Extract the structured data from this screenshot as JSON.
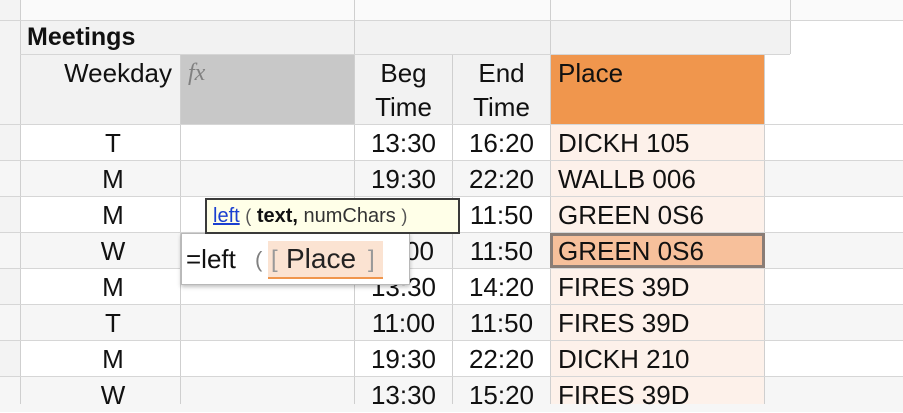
{
  "section_title": "Meetings",
  "headers": {
    "weekday": "Weekday",
    "fx_icon": "fx",
    "beg_line1": "Beg",
    "beg_line2": "Time",
    "end_line1": "End",
    "end_line2": "Time",
    "place": "Place"
  },
  "rows": [
    {
      "weekday": "T",
      "beg": "13:30",
      "end": "16:20",
      "place": "DICKH 105"
    },
    {
      "weekday": "M",
      "beg": "19:30",
      "end": "22:20",
      "place": "WALLB 006"
    },
    {
      "weekday": "M",
      "beg": "",
      "end": "11:50",
      "place": "GREEN 0S6"
    },
    {
      "weekday": "W",
      "beg": "",
      "end": "11:50",
      "place": "GREEN 0S6"
    },
    {
      "weekday": "M",
      "beg": "13:30",
      "end": "14:20",
      "place": "FIRES 39D"
    },
    {
      "weekday": "T",
      "beg": "11:00",
      "end": "11:50",
      "place": "FIRES 39D"
    },
    {
      "weekday": "M",
      "beg": "19:30",
      "end": "22:20",
      "place": "DICKH 210"
    },
    {
      "weekday": "W",
      "beg": "13:30",
      "end": "15:20",
      "place": "FIRES 39D"
    }
  ],
  "row4_beg_partial": "00",
  "row5_beg_partial": "13:30",
  "tooltip": {
    "function_name": "left",
    "open_paren": "(",
    "arg1": "text,",
    "arg2": "numChars",
    "close_paren": ")"
  },
  "formula_editor": {
    "prefix": "=left",
    "open_paren": "(",
    "bracket_open": "[",
    "reference": "Place",
    "bracket_close": "]"
  },
  "colors": {
    "place_header": "#f0964d",
    "place_column_tint": "#fdf1ea",
    "selected_cell": "#f7c09b",
    "fx_header": "#c8c8c8",
    "tooltip_bg": "#ffffe8",
    "reference_chip": "#fbe3d2"
  }
}
